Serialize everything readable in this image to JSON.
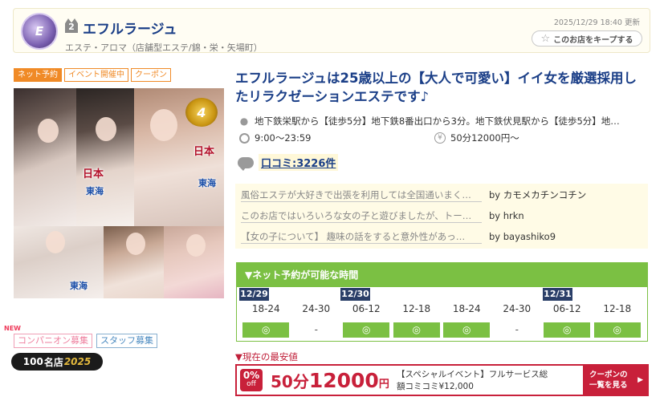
{
  "header": {
    "logo_text": "E",
    "rank": "2",
    "shop_name": "エフルラージュ",
    "category": "エステ・アロマ（店舗型エステ/錦・栄・矢場町）",
    "updated": "2025/12/29 18:40 更新",
    "keep_label": "このお店をキープする"
  },
  "tags": [
    "ネット予約",
    "イベント開催中",
    "クーポン"
  ],
  "photos": {
    "badge_nihon": "日本",
    "badge_tokai": "東海",
    "crown_text": "4"
  },
  "recruit": {
    "new_mark": "NEW",
    "companion": "コンパニオン募集",
    "staff": "スタッフ募集",
    "award_prefix": "100",
    "award_name": "名店",
    "award_year": "2025"
  },
  "main": {
    "title": "エフルラージュは25歳以上の【大人で可愛い】イイ女を厳選採用したリラクゼーションエステです♪",
    "access": "地下鉄栄駅から【徒歩5分】地下鉄8番出口から3分。地下鉄伏見駅から【徒歩5分】地…",
    "hours": "9:00～23:59",
    "price": "50分12000円～",
    "kuchikomi": "口コミ:3226件"
  },
  "reviews": [
    {
      "text": "風俗エステが大好きで出張を利用しては全国通いまく…",
      "by": "by カモメカチンコチン"
    },
    {
      "text": "このお店ではいろいろな女の子と遊びましたが、トー…",
      "by": "by hrkn"
    },
    {
      "text": "【女の子について】 趣味の話をすると意外性があっ…",
      "by": "by bayashiko9"
    }
  ],
  "reservation": {
    "header": "▼ネット予約が可能な時間",
    "dates": [
      "12/29",
      "12/30",
      "12/31"
    ],
    "slots": [
      "18-24",
      "24-30",
      "06-12",
      "12-18",
      "18-24",
      "24-30",
      "06-12",
      "12-18"
    ],
    "available": [
      true,
      false,
      true,
      true,
      true,
      false,
      true,
      true
    ],
    "on_mark": "◎",
    "off_mark": "-"
  },
  "best_price": {
    "label": "▼現在の最安値",
    "off_num": "0%",
    "off_text": "off",
    "minutes": "50分",
    "yen": "12000",
    "unit": "円",
    "desc_line1": "【スペシャルイベント】フルサービス総",
    "desc_line2": "額コミコミ¥12,000",
    "btn_line1": "クーポンの",
    "btn_line2": "一覧を見る"
  },
  "colors": {
    "accent_blue": "#1a3e87",
    "tag_orange": "#f08a26",
    "reserve_green": "#7bc043",
    "date_navy": "#2a3e68",
    "price_red": "#c8203a"
  }
}
